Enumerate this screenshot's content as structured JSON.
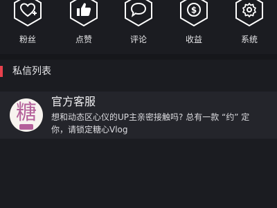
{
  "nav": {
    "items": [
      {
        "label": "粉丝",
        "icon": "heart-plus-icon"
      },
      {
        "label": "点赞",
        "icon": "thumbs-up-icon"
      },
      {
        "label": "评论",
        "icon": "speech-bubble-icon"
      },
      {
        "label": "收益",
        "icon": "dollar-coin-icon"
      },
      {
        "label": "系统",
        "icon": "gear-icon"
      }
    ]
  },
  "section": {
    "title": "私信列表"
  },
  "messages": [
    {
      "name": "官方客服",
      "avatar_text": "糖",
      "preview": "想和动态区心仪的UP主亲密接触吗? 总有一款 “约” 定你，请锁定糖心Vlog"
    }
  ],
  "colors": {
    "background": "#1b1c21",
    "accent": "#e8414d",
    "list_item_bg": "#24252b",
    "icon_stroke": "#ffffff"
  }
}
